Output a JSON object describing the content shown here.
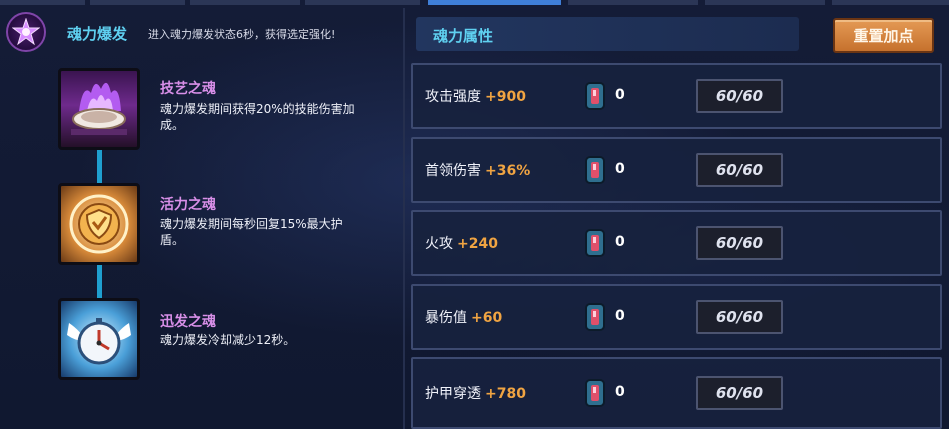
{
  "burst": {
    "title": "魂力爆发",
    "description": "进入魂力爆发状态6秒，获得选定强化!",
    "emblem_icon": "purple-star-emblem-icon"
  },
  "skills": [
    {
      "name": "技艺之魂",
      "description": "魂力爆发期间获得20%的技能伤害加成。",
      "icon": "purple-flame-bowl-icon"
    },
    {
      "name": "活力之魂",
      "description": "魂力爆发期间每秒回复15%最大护盾。",
      "icon": "golden-shield-orb-icon"
    },
    {
      "name": "迅发之魂",
      "description": "魂力爆发冷却减少12秒。",
      "icon": "winged-clock-icon"
    }
  ],
  "attributes": {
    "title": "魂力属性",
    "reset_label": "重置加点",
    "rows": [
      {
        "label": "攻击强度",
        "bonus": "+900",
        "count": "0",
        "level": "60/60"
      },
      {
        "label": "首领伤害",
        "bonus": "+36%",
        "count": "0",
        "level": "60/60"
      },
      {
        "label": "火攻",
        "bonus": "+240",
        "count": "0",
        "level": "60/60"
      },
      {
        "label": "暴伤值",
        "bonus": "+60",
        "count": "0",
        "level": "60/60"
      },
      {
        "label": "护甲穿透",
        "bonus": "+780",
        "count": "0",
        "level": "60/60"
      }
    ]
  },
  "colors": {
    "accent_title": "#5fd0f0",
    "skill_name": "#d88fe8",
    "bonus": "#f0a442",
    "reset_button": "#d98440",
    "connector": "#1f9fcf"
  }
}
